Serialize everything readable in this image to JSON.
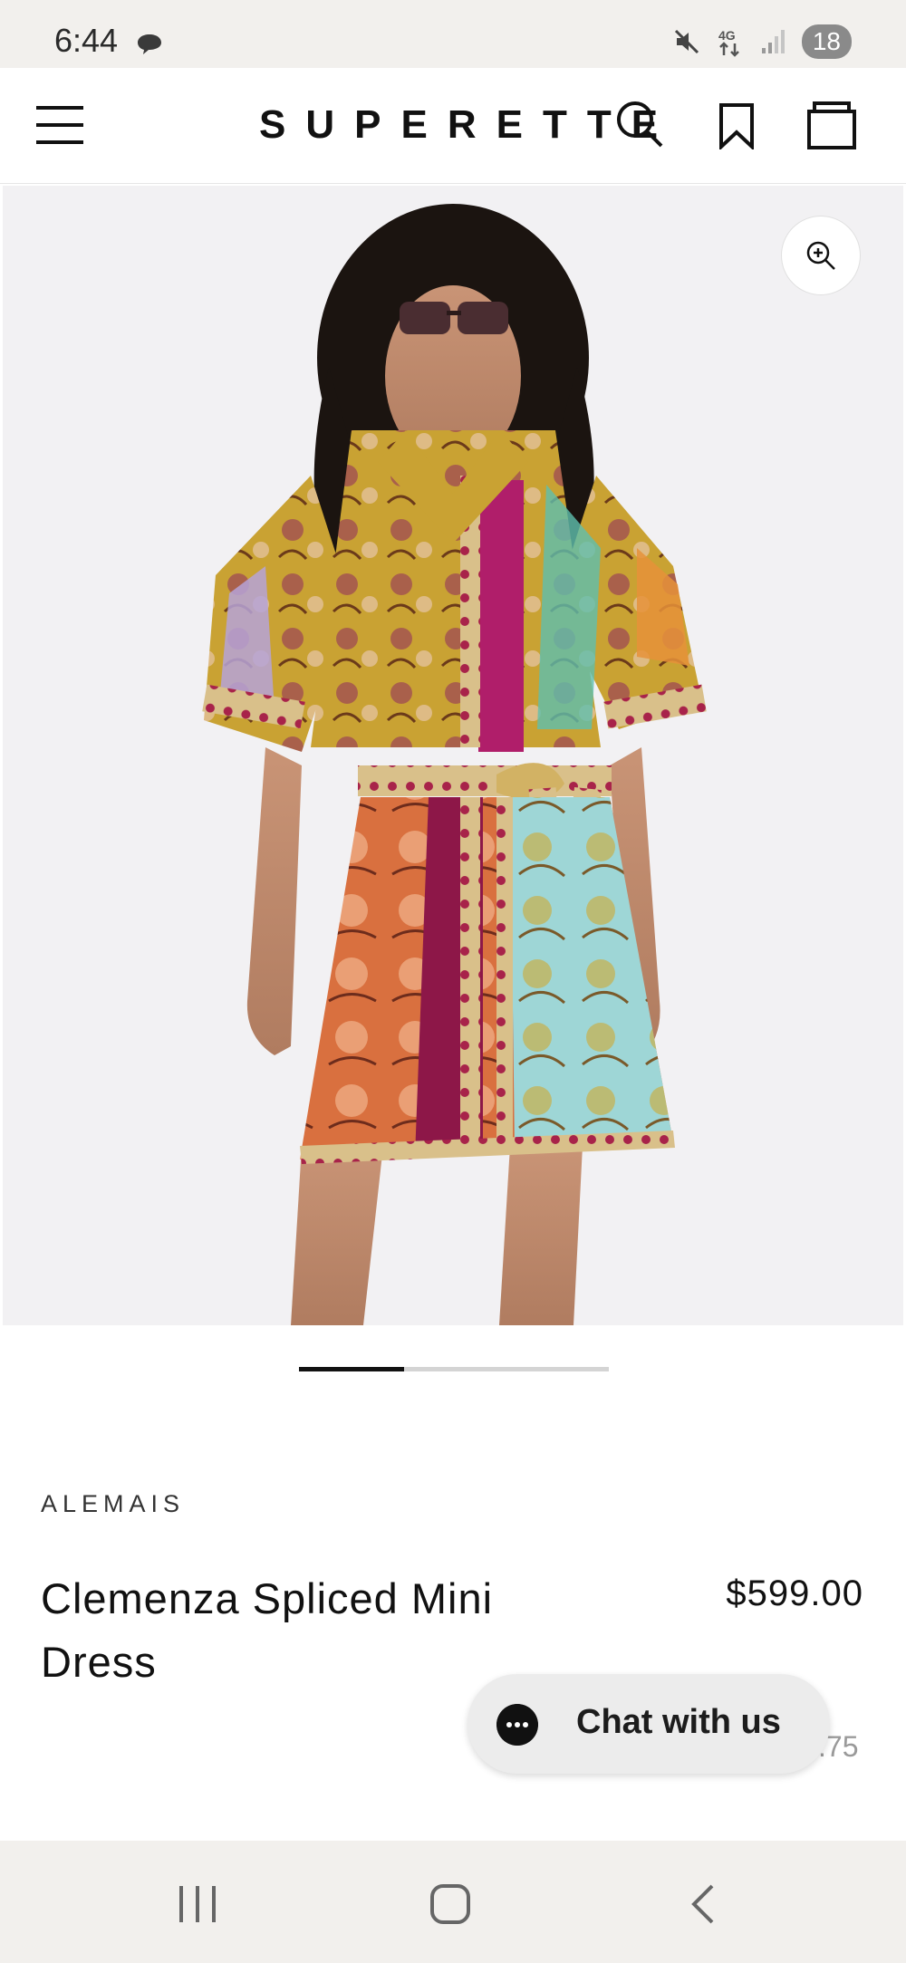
{
  "status_bar": {
    "time": "6:44",
    "network": "4G",
    "battery": "18"
  },
  "header": {
    "brand": "SUPERETTE",
    "icons": [
      "menu-icon",
      "search-icon",
      "bookmark-icon",
      "bag-icon"
    ]
  },
  "product": {
    "image_icons": [
      "zoom-in-icon"
    ],
    "carousel_progress": 0.34,
    "brand_name": "ALEMAIS",
    "title": "Clemenza Spliced Mini Dress",
    "price": "$599.00",
    "partial_text": ".75"
  },
  "chat": {
    "label": "Chat with us"
  },
  "nav": {
    "icons": [
      "recents-icon",
      "home-icon",
      "back-icon"
    ]
  }
}
